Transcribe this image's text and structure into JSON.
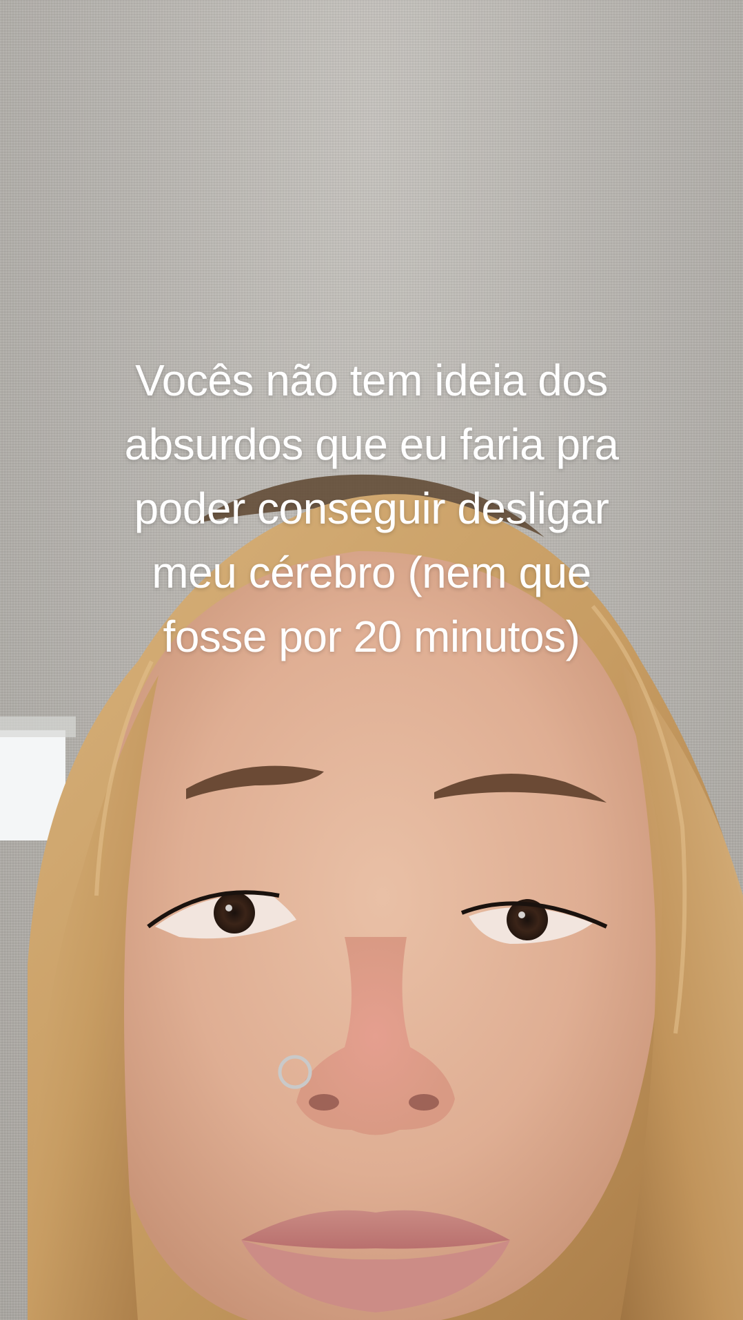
{
  "caption": {
    "lines": [
      "Vocês não tem ideia dos",
      "absurdos que eu faria pra",
      "poder conseguir desligar",
      "meu cérebro (nem que",
      "fosse por 20 minutos)"
    ]
  },
  "colors": {
    "ceiling": "#b9b6b1",
    "hair": "#c9a36f",
    "skin": "#e3b79d",
    "caption_text": "#ffffff"
  }
}
